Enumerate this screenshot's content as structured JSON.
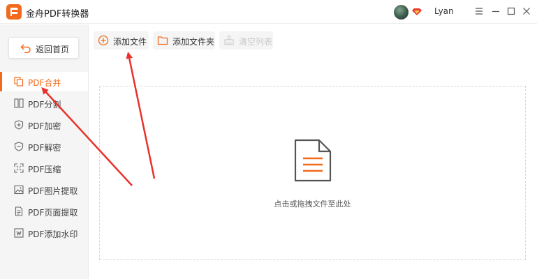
{
  "app": {
    "title": "金舟PDF转换器",
    "user": "Lyan",
    "brand_color": "#f26b1d"
  },
  "window_controls": [
    "menu-icon",
    "minimize-icon",
    "maximize-icon",
    "close-icon"
  ],
  "sidebar": {
    "back_label": "返回首页",
    "items": [
      {
        "label": "PDF合并",
        "icon": "merge-icon",
        "active": true
      },
      {
        "label": "PDF分割",
        "icon": "split-icon",
        "active": false
      },
      {
        "label": "PDF加密",
        "icon": "shield-plus-icon",
        "active": false
      },
      {
        "label": "PDF解密",
        "icon": "shield-minus-icon",
        "active": false
      },
      {
        "label": "PDF压缩",
        "icon": "compress-icon",
        "active": false
      },
      {
        "label": "PDF图片提取",
        "icon": "image-icon",
        "active": false
      },
      {
        "label": "PDF页面提取",
        "icon": "page-icon",
        "active": false
      },
      {
        "label": "PDF添加水印",
        "icon": "watermark-icon",
        "active": false
      }
    ]
  },
  "toolbar": {
    "add_file": "添加文件",
    "add_folder": "添加文件夹",
    "clear_list": "清空列表"
  },
  "dropzone": {
    "hint": "点击或拖拽文件至此处"
  }
}
